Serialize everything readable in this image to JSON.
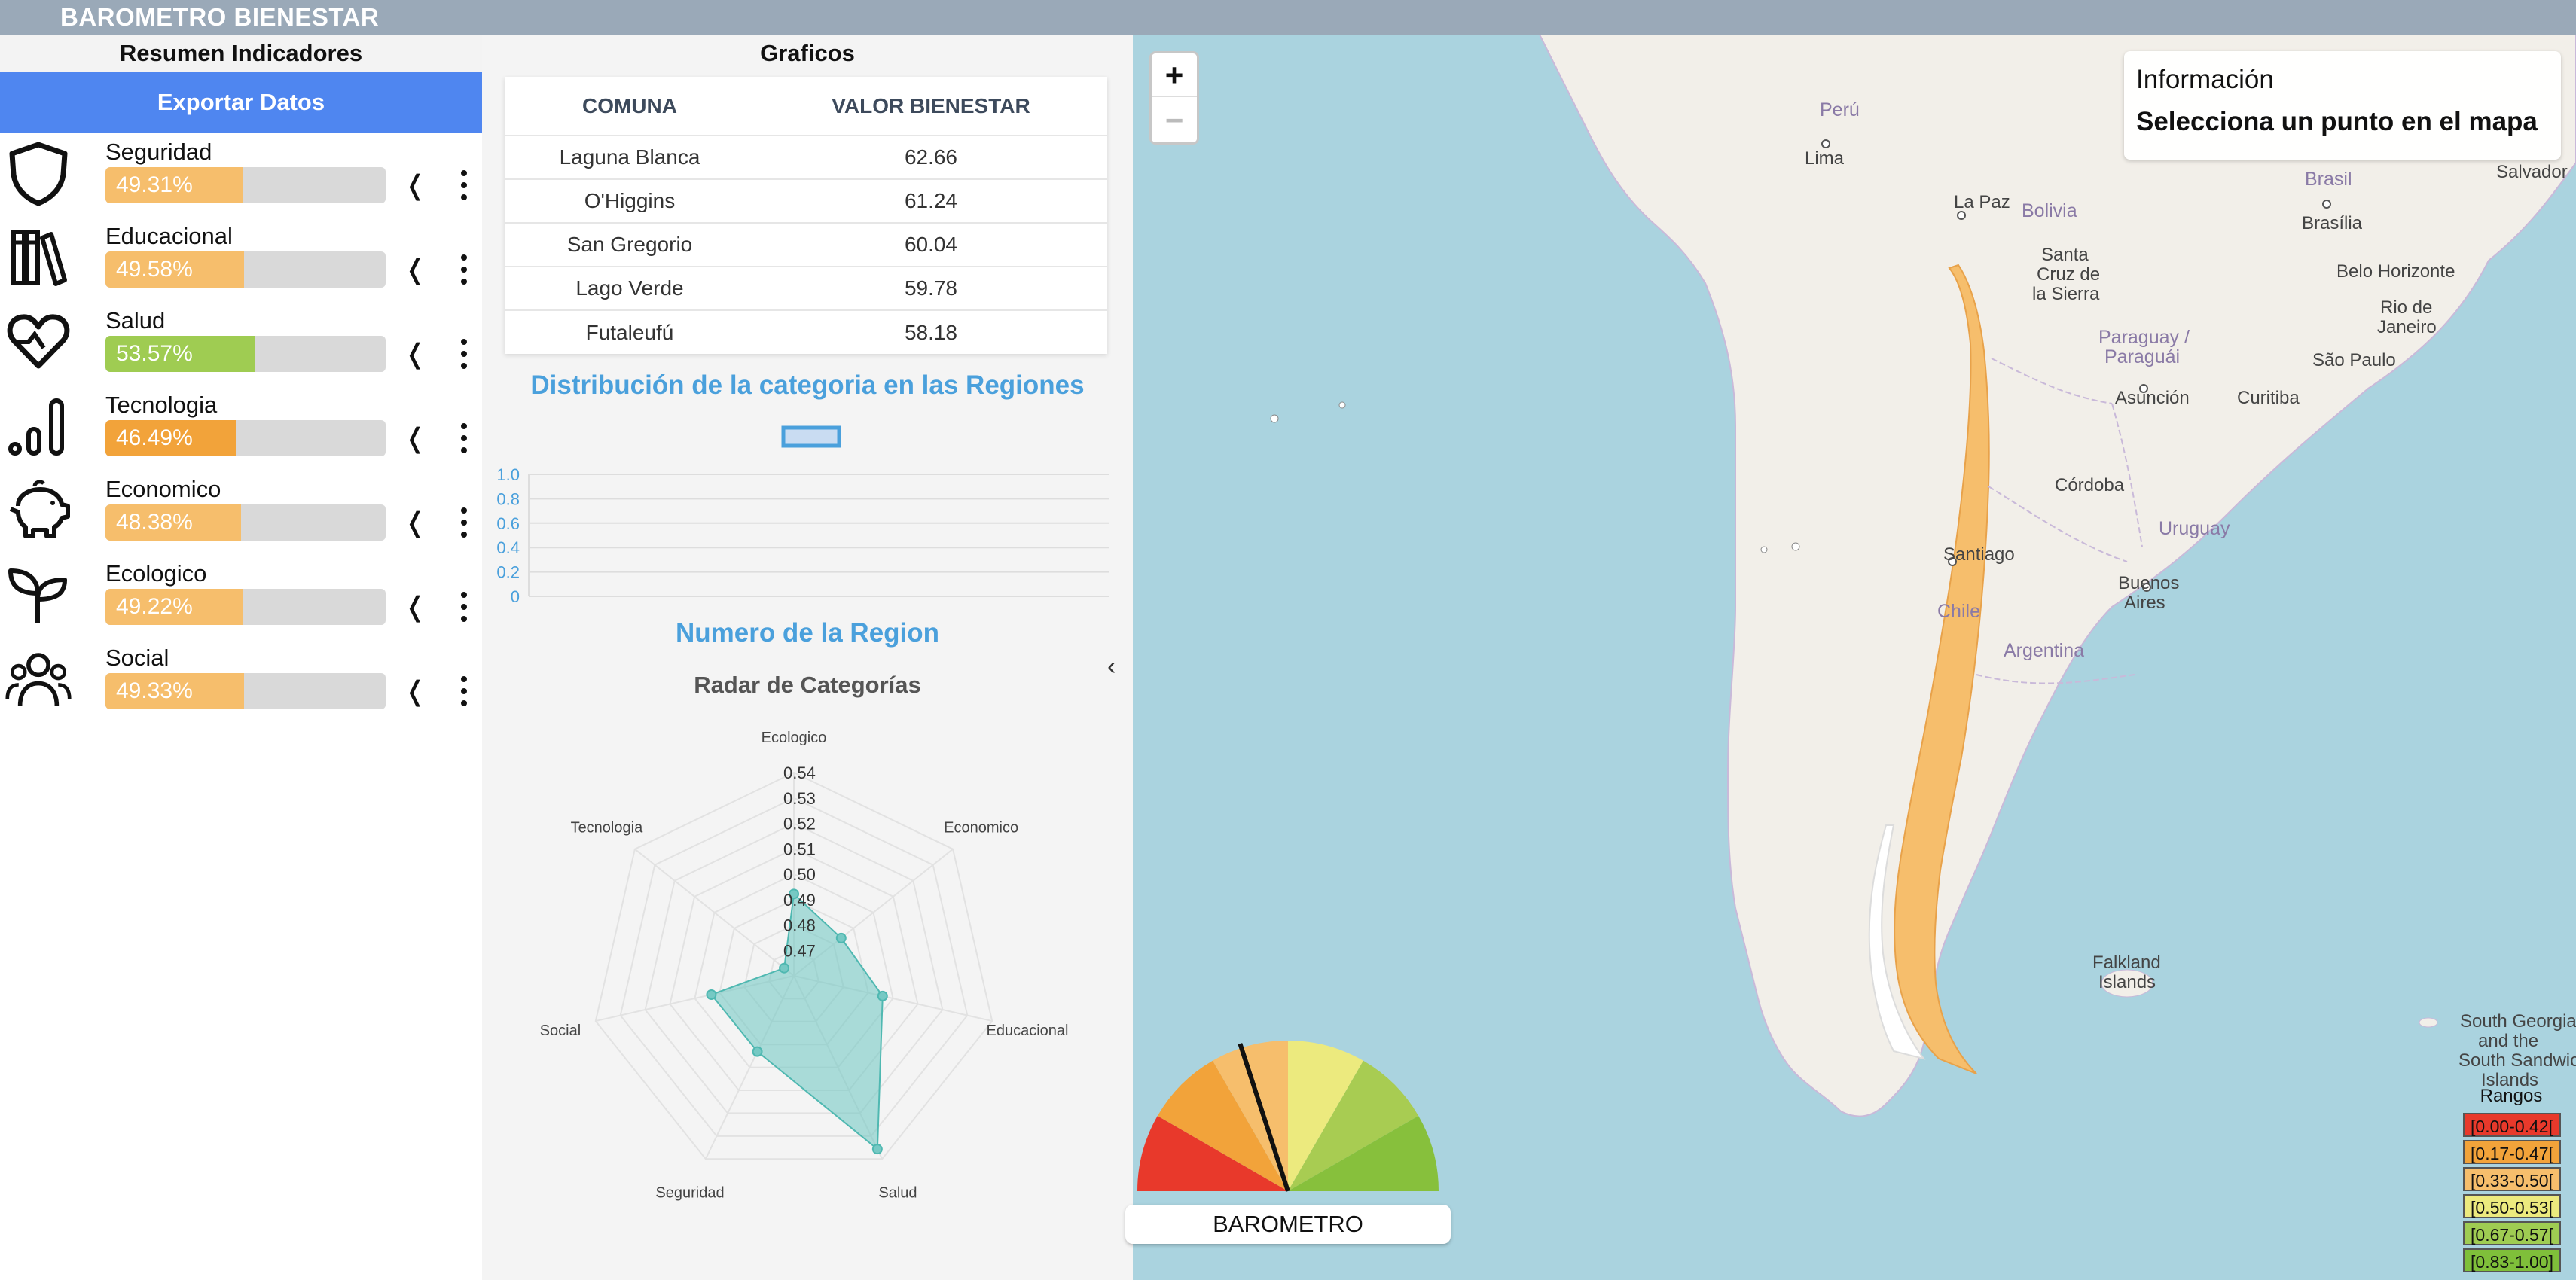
{
  "app": {
    "title": "BAROMETRO BIENESTAR"
  },
  "left": {
    "header": "Resumen Indicadores",
    "export_label": "Exportar Datos",
    "collapse_glyph": "❬",
    "indicators": [
      {
        "icon": "shield-icon",
        "label": "Seguridad",
        "value": "49.31%",
        "fraction": 0.4931,
        "color": "#f6be6c"
      },
      {
        "icon": "books-icon",
        "label": "Educacional",
        "value": "49.58%",
        "fraction": 0.4958,
        "color": "#f6be6c"
      },
      {
        "icon": "heart-icon",
        "label": "Salud",
        "value": "53.57%",
        "fraction": 0.5357,
        "color": "#9fcc52"
      },
      {
        "icon": "bar-chart-icon",
        "label": "Tecnologia",
        "value": "46.49%",
        "fraction": 0.4649,
        "color": "#f2a33a"
      },
      {
        "icon": "piggy-bank-icon",
        "label": "Economico",
        "value": "48.38%",
        "fraction": 0.4838,
        "color": "#f6be6c"
      },
      {
        "icon": "sprout-icon",
        "label": "Ecologico",
        "value": "49.22%",
        "fraction": 0.4922,
        "color": "#f6be6c"
      },
      {
        "icon": "users-icon",
        "label": "Social",
        "value": "49.33%",
        "fraction": 0.4933,
        "color": "#f6be6c"
      }
    ]
  },
  "middle": {
    "header": "Graficos",
    "table": {
      "columns": [
        "COMUNA",
        "VALOR BIENESTAR"
      ],
      "rows": [
        [
          "Laguna Blanca",
          "62.66"
        ],
        [
          "O'Higgins",
          "61.24"
        ],
        [
          "San Gregorio",
          "60.04"
        ],
        [
          "Lago Verde",
          "59.78"
        ],
        [
          "Futaleufú",
          "58.18"
        ]
      ]
    },
    "collapse_glyph": "‹"
  },
  "chart_data": [
    {
      "type": "bar",
      "title": "Distribución de la categoria en las Regiones",
      "xlabel": "Numero de la Region",
      "ylabel": "",
      "categories": [],
      "values": [],
      "ylim": [
        0,
        1.0
      ],
      "yticks": [
        "1.0",
        "0.8",
        "0.6",
        "0.4",
        "0.2",
        "0"
      ],
      "grid": true,
      "legend": "top-center"
    },
    {
      "type": "radar",
      "title": "Radar de Categorías",
      "axes": [
        "Ecologico",
        "Economico",
        "Educacional",
        "Salud",
        "Seguridad",
        "Social",
        "Tecnologia"
      ],
      "values": [
        0.4922,
        0.4838,
        0.4958,
        0.5357,
        0.4931,
        0.4933,
        0.4649
      ],
      "rmin": 0.46,
      "rmax": 0.54,
      "ticks": [
        "0.47",
        "0.48",
        "0.49",
        "0.50",
        "0.51",
        "0.52",
        "0.53",
        "0.54"
      ],
      "color": "#76c9c4"
    }
  ],
  "map": {
    "zoom_in": "+",
    "zoom_out": "−",
    "info": {
      "title": "Información",
      "text": "Selecciona un punto en el mapa"
    },
    "places": {
      "peru": "Perú",
      "lima": "Lima",
      "bolivia": "Bolivia",
      "la_paz": "La Paz",
      "santa_cruz_1": "Santa",
      "santa_cruz_2": "Cruz de",
      "santa_cruz_3": "la Sierra",
      "brasil": "Brasil",
      "brasilia": "Brasília",
      "salvador": "Salvador",
      "belo_1": "Belo Horizonte",
      "rio_1": "Rio de",
      "rio_2": "Janeiro",
      "sao_paulo": "São Paulo",
      "curitiba": "Curitiba",
      "paraguay_1": "Paraguay /",
      "paraguay_2": "Paraguái",
      "asuncion": "Asunción",
      "cordoba": "Córdoba",
      "uruguay": "Uruguay",
      "santiago": "Santiago",
      "buenos_1": "Buenos",
      "buenos_2": "Aires",
      "chile": "Chile",
      "argentina": "Argentina",
      "falkland_1": "Falkland",
      "falkland_2": "Islands",
      "sg_1": "South Georgia",
      "sg_2": "and the",
      "sg_3": "South Sandwich",
      "sg_4": "Islands"
    },
    "legend": {
      "title": "Rangos",
      "items": [
        {
          "label": "[0.00-0.42[",
          "color": "#e8392b"
        },
        {
          "label": "[0.17-0.47[",
          "color": "#f2a33a"
        },
        {
          "label": "[0.33-0.50[",
          "color": "#f6be6c"
        },
        {
          "label": "[0.50-0.53[",
          "color": "#ecea7e"
        },
        {
          "label": "[0.67-0.57[",
          "color": "#9fcc52"
        },
        {
          "label": "[0.83-1.00]",
          "color": "#7fbf3a"
        }
      ]
    },
    "gauge": {
      "label": "BAROMETRO",
      "value": 0.4,
      "segments": [
        "#e8392b",
        "#f2a33a",
        "#f6be6c",
        "#ecea7e",
        "#a8cc52",
        "#87c03c"
      ]
    }
  }
}
